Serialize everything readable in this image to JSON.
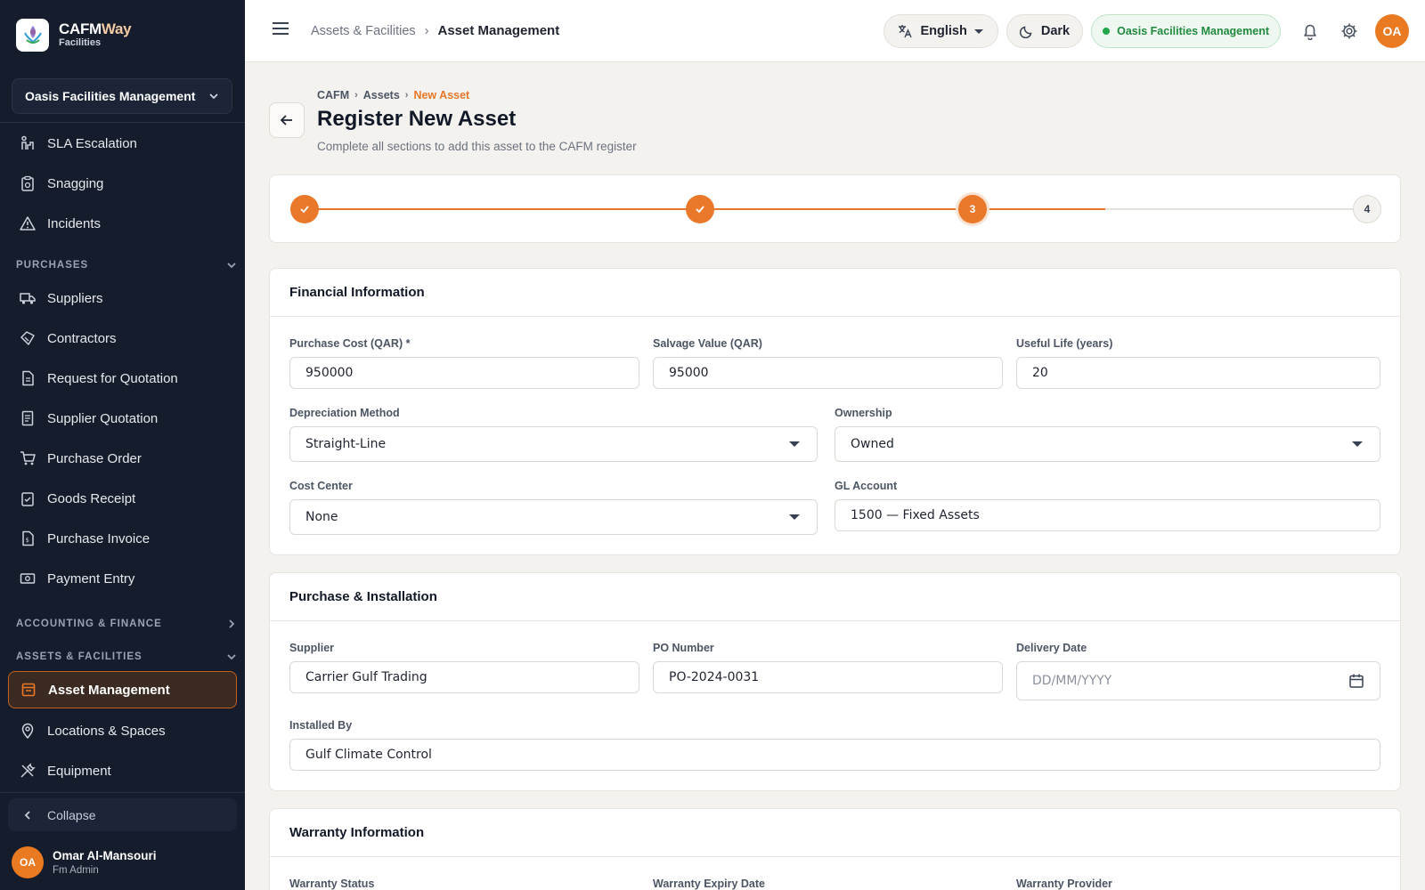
{
  "sidebar": {
    "brand_name_a": "CAFM",
    "brand_name_b": "Way",
    "brand_sub": "Facilities",
    "org": "Oasis Facilities Management",
    "items_top": [
      {
        "label": "SLA Escalation",
        "icon": "escalation-icon"
      },
      {
        "label": "Snagging",
        "icon": "clipboard-icon"
      },
      {
        "label": "Incidents",
        "icon": "warning-icon"
      }
    ],
    "section_purchases": "PURCHASES",
    "purchases": [
      {
        "label": "Suppliers",
        "icon": "truck-icon"
      },
      {
        "label": "Contractors",
        "icon": "handshake-icon"
      },
      {
        "label": "Request for Quotation",
        "icon": "document-icon"
      },
      {
        "label": "Supplier Quotation",
        "icon": "receipt-icon"
      },
      {
        "label": "Purchase Order",
        "icon": "cart-icon"
      },
      {
        "label": "Goods Receipt",
        "icon": "checklist-icon"
      },
      {
        "label": "Purchase Invoice",
        "icon": "invoice-icon"
      },
      {
        "label": "Payment Entry",
        "icon": "cash-icon"
      }
    ],
    "section_accounting": "ACCOUNTING & FINANCE",
    "section_assets": "ASSETS & FACILITIES",
    "assets": [
      {
        "label": "Asset Management",
        "icon": "asset-icon",
        "active": true
      },
      {
        "label": "Locations & Spaces",
        "icon": "pin-icon"
      },
      {
        "label": "Equipment",
        "icon": "tools-icon"
      }
    ],
    "collapse": "Collapse",
    "user_initials": "OA",
    "user_name": "Omar Al-Mansouri",
    "user_role": "Fm Admin"
  },
  "header": {
    "crumb_parent": "Assets & Facilities",
    "crumb_current": "Asset Management",
    "language": "English",
    "theme": "Dark",
    "org": "Oasis Facilities Management",
    "avatar": "OA"
  },
  "page": {
    "crumbs": [
      "CAFM",
      "Assets",
      "New Asset"
    ],
    "title": "Register New Asset",
    "subtitle": "Complete all sections to add this asset to the CAFM register"
  },
  "stepper": {
    "steps": [
      {
        "label": "",
        "state": "done"
      },
      {
        "label": "",
        "state": "done"
      },
      {
        "label": "3",
        "state": "current"
      },
      {
        "label": "4",
        "state": "pending"
      }
    ],
    "accent": "#e9782a"
  },
  "financial": {
    "title": "Financial Information",
    "purchase_cost_label": "Purchase Cost (QAR) *",
    "purchase_cost": "950000",
    "salvage_label": "Salvage Value (QAR)",
    "salvage": "95000",
    "useful_life_label": "Useful Life (years)",
    "useful_life": "20",
    "depreciation_label": "Depreciation Method",
    "depreciation": "Straight-Line",
    "ownership_label": "Ownership",
    "ownership": "Owned",
    "cost_center_label": "Cost Center",
    "cost_center": "None",
    "gl_label": "GL Account",
    "gl": "1500 — Fixed Assets"
  },
  "purchase": {
    "title": "Purchase & Installation",
    "supplier_label": "Supplier",
    "supplier": "Carrier Gulf Trading",
    "po_label": "PO Number",
    "po": "PO-2024-0031",
    "delivery_label": "Delivery Date",
    "delivery_placeholder": "DD/MM/YYYY",
    "installed_label": "Installed By",
    "installed": "Gulf Climate Control"
  },
  "warranty": {
    "title": "Warranty Information",
    "status_label": "Warranty Status",
    "expiry_label": "Warranty Expiry Date",
    "provider_label": "Warranty Provider"
  }
}
